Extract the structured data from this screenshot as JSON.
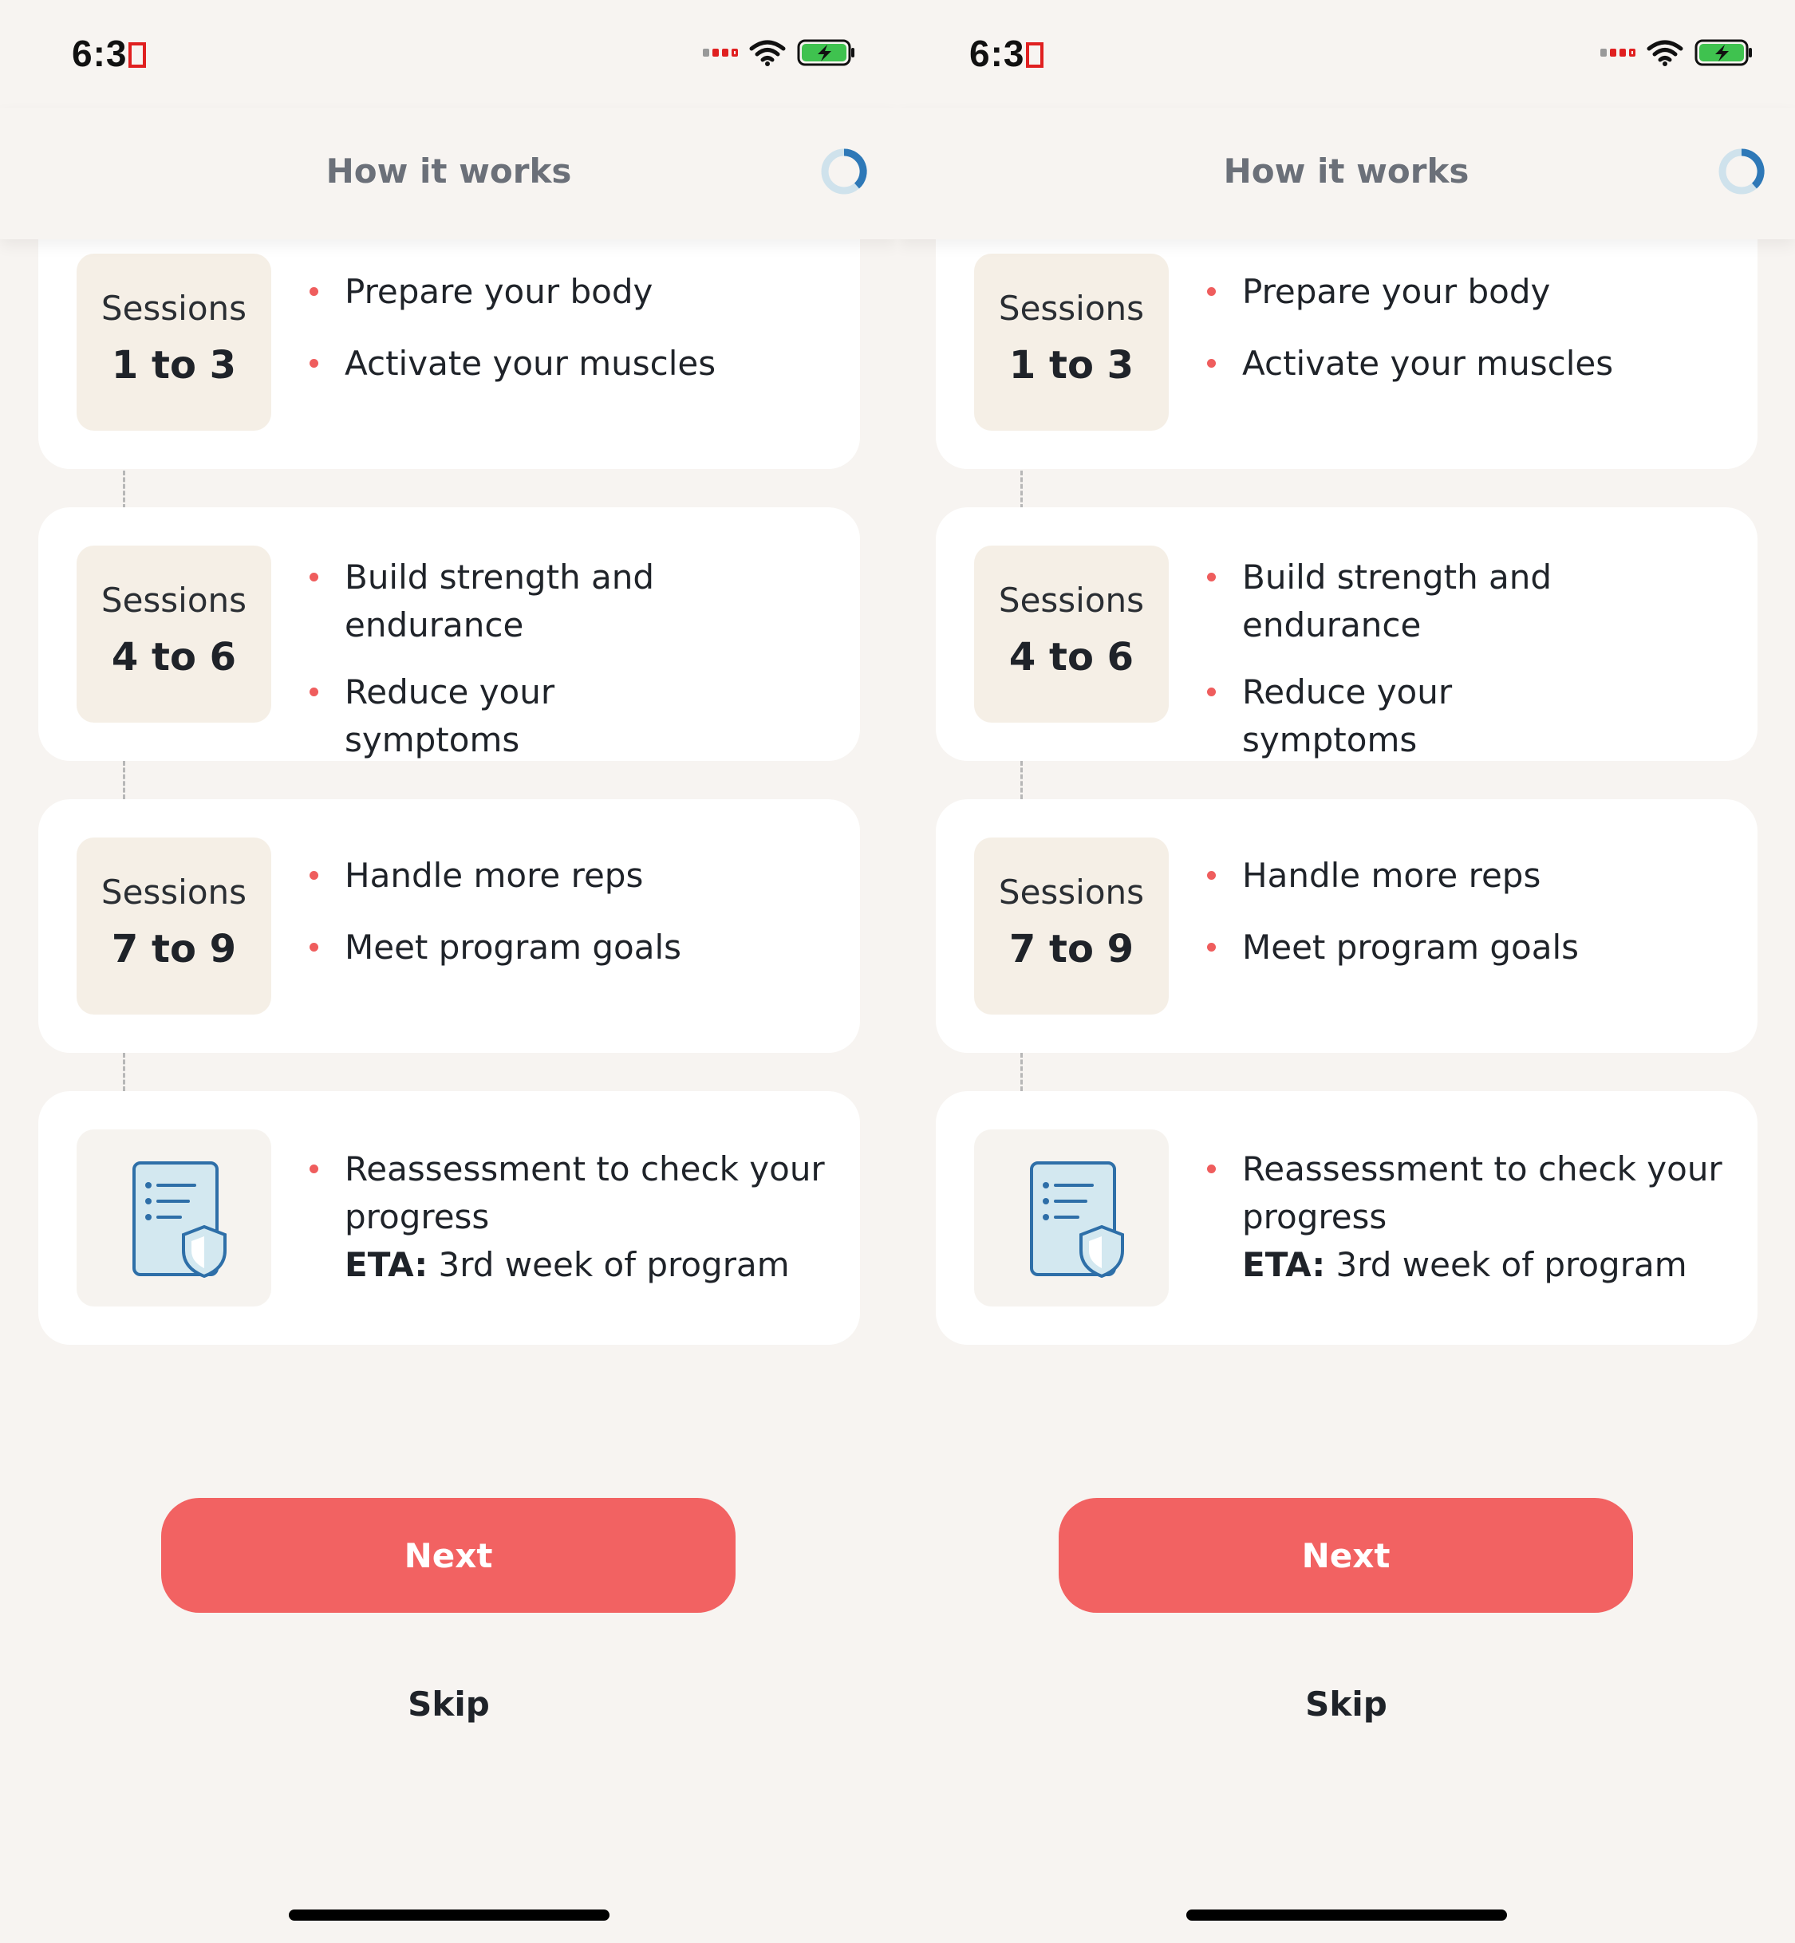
{
  "screens": [
    {
      "status_time": "6:3",
      "header": {
        "title": "How it works"
      },
      "cards": [
        {
          "badge_top": "Sessions",
          "badge_num": "1 to 3",
          "bullets": [
            "Prepare your body",
            "Activate your muscles"
          ]
        },
        {
          "badge_top": "Sessions",
          "badge_num": "4 to 6",
          "bullets": [
            "Build strength and endurance",
            "Reduce your symptoms"
          ]
        },
        {
          "badge_top": "Sessions",
          "badge_num": "7 to 9",
          "bullets": [
            "Handle more reps",
            "Meet program goals"
          ]
        },
        {
          "icon": "document-shield-icon",
          "bullets": [
            "Reassessment to check your progress"
          ],
          "eta_label": "ETA:",
          "eta_value": "3rd week of program"
        }
      ],
      "next_label": "Next",
      "skip_label": "Skip"
    },
    {
      "status_time": "6:3",
      "header": {
        "title": "How it works"
      },
      "cards": [
        {
          "badge_top": "Sessions",
          "badge_num": "1 to 3",
          "bullets": [
            "Prepare your body",
            "Activate your muscles"
          ]
        },
        {
          "badge_top": "Sessions",
          "badge_num": "4 to 6",
          "bullets": [
            "Build strength and endurance",
            "Reduce your symptoms"
          ]
        },
        {
          "badge_top": "Sessions",
          "badge_num": "7 to 9",
          "bullets": [
            "Handle more reps",
            "Meet program goals"
          ]
        },
        {
          "icon": "document-shield-icon",
          "bullets": [
            "Reassessment to check your progress"
          ],
          "eta_label": "ETA:",
          "eta_value": "3rd week of program"
        }
      ],
      "next_label": "Next",
      "skip_label": "Skip"
    }
  ],
  "colors": {
    "accent": "#f26262",
    "bullet": "#ef5d5d",
    "badge_bg": "#f5efe6",
    "page_bg": "#f7f4f1",
    "progress_ring": "#2e78b7"
  }
}
